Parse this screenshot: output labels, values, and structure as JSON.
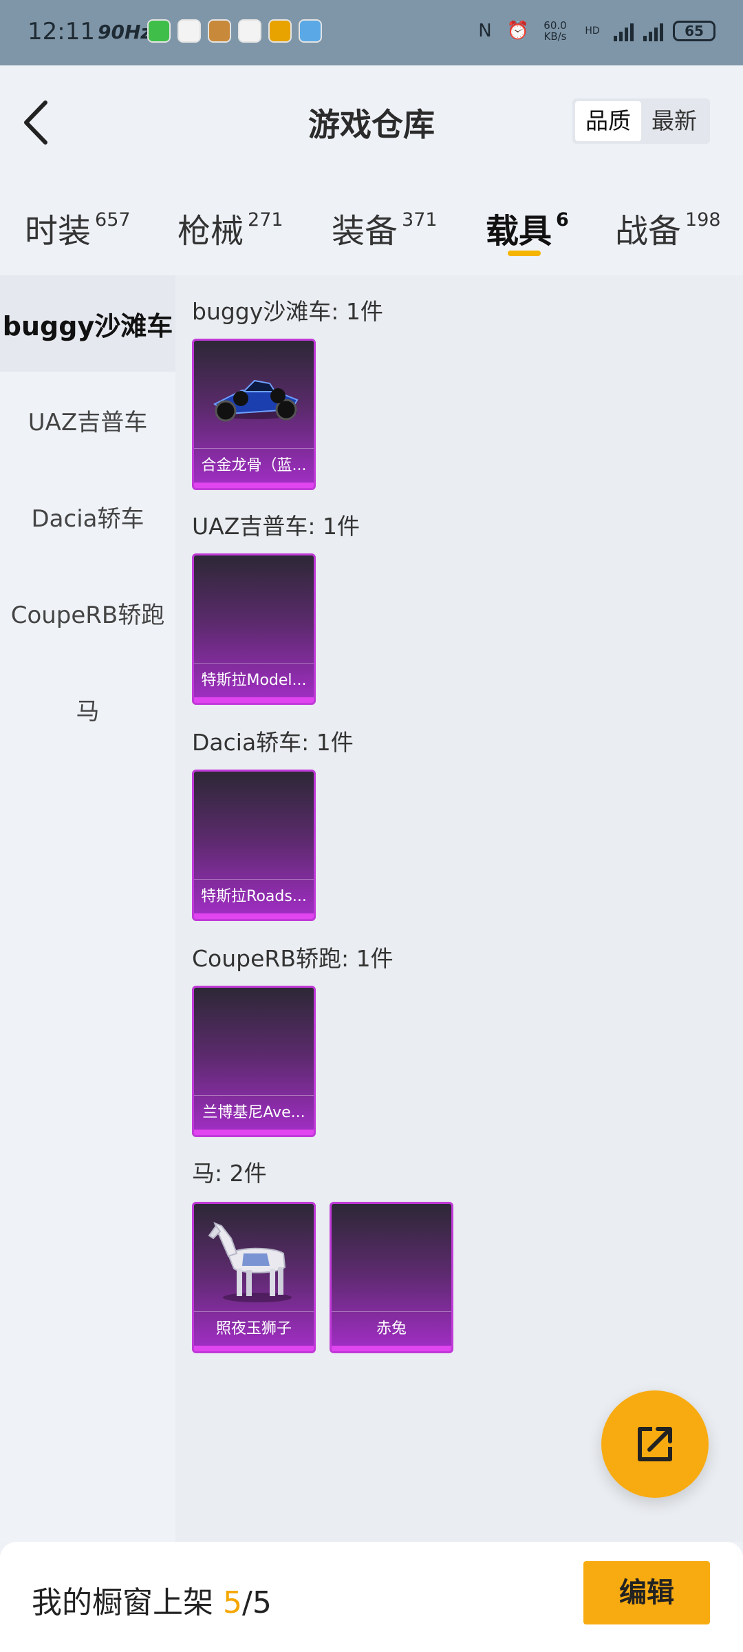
{
  "status_bar": {
    "time": "12:11",
    "refresh_rate": "90Hz",
    "net_speed": "60.0 KB/s",
    "battery": "65",
    "icons": [
      "wechat-icon",
      "chat-icon",
      "store-icon",
      "trash-icon",
      "shield-icon",
      "app-icon",
      "nfc-icon",
      "alarm-icon",
      "hd-icon",
      "signal-5g-icon",
      "signal-5g-icon",
      "battery-icon"
    ]
  },
  "header": {
    "title": "游戏仓库",
    "sort_options": [
      "品质",
      "最新"
    ],
    "active_sort": "品质"
  },
  "tabs": [
    {
      "label": "时装",
      "count": "657"
    },
    {
      "label": "枪械",
      "count": "271"
    },
    {
      "label": "装备",
      "count": "371"
    },
    {
      "label": "载具",
      "count": "6"
    },
    {
      "label": "战备",
      "count": "198"
    }
  ],
  "active_tab": "载具",
  "sidebar": {
    "items": [
      "buggy沙滩车",
      "UAZ吉普车",
      "Dacia轿车",
      "CoupeRB轿跑",
      "马"
    ],
    "active": "buggy沙滩车"
  },
  "sections": [
    {
      "title": "buggy沙滩车: 1件",
      "items": [
        {
          "name": "合金龙骨（蓝...",
          "art": "buggy-icon"
        }
      ]
    },
    {
      "title": "UAZ吉普车: 1件",
      "items": [
        {
          "name": "特斯拉Model...",
          "art": ""
        }
      ]
    },
    {
      "title": "Dacia轿车: 1件",
      "items": [
        {
          "name": "特斯拉Roads...",
          "art": ""
        }
      ]
    },
    {
      "title": "CoupeRB轿跑: 1件",
      "items": [
        {
          "name": "兰博基尼Ave...",
          "art": ""
        }
      ]
    },
    {
      "title": "马: 2件",
      "items": [
        {
          "name": "照夜玉狮子",
          "art": "horse-icon"
        },
        {
          "name": "赤兔",
          "art": ""
        }
      ]
    }
  ],
  "bottom_bar": {
    "label": "我的橱窗上架",
    "count": "5",
    "separator": "/",
    "total": "5",
    "edit_label": "编辑"
  },
  "colors": {
    "accent": "#f8ab10",
    "card_border": "#c03ad8",
    "tab_underline": "#f5b400"
  }
}
